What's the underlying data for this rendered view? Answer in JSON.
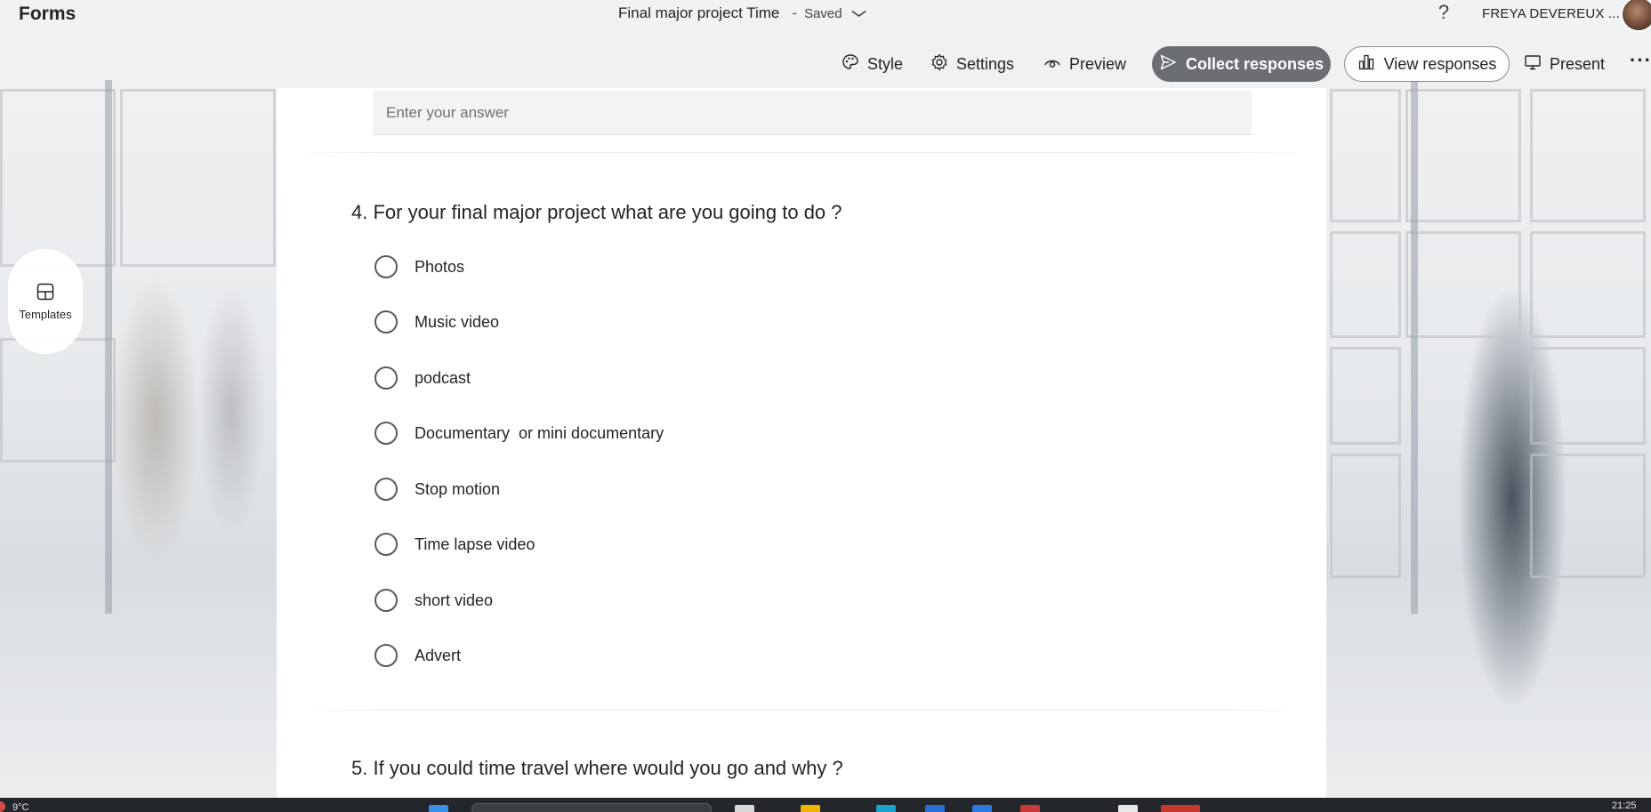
{
  "app": {
    "name": "Forms"
  },
  "document": {
    "title": "Final major project Time",
    "separator": "-",
    "status": "Saved"
  },
  "header": {
    "help_label": "?",
    "user_name": "FREYA DEVEREUX ..."
  },
  "toolbar": {
    "style_label": "Style",
    "settings_label": "Settings",
    "preview_label": "Preview",
    "collect_label": "Collect responses",
    "view_responses_label": "View responses",
    "present_label": "Present",
    "more_label": "···"
  },
  "sidebar": {
    "templates_label": "Templates"
  },
  "form": {
    "answer_placeholder": "Enter your answer",
    "question4": {
      "title": "4. For your final major project what are you going to do ?",
      "options": [
        "Photos",
        "Music video",
        "podcast",
        "Documentary  or mini documentary",
        "Stop motion",
        "Time lapse video",
        "short video",
        "Advert"
      ]
    },
    "question5": {
      "title": "5. If you could time travel where would you go and why ?"
    }
  },
  "taskbar": {
    "weather": "9°C",
    "clock": "21:25"
  },
  "colors": {
    "accent_button": "#6b6e72",
    "card": "#ffffff",
    "taskbar": "#23262b"
  },
  "icons": {
    "style": "palette-icon",
    "settings": "gear-icon",
    "preview": "eye-icon",
    "collect": "send-icon",
    "view_responses": "bar-chart-icon",
    "present": "monitor-icon",
    "templates": "grid-layout-icon"
  }
}
